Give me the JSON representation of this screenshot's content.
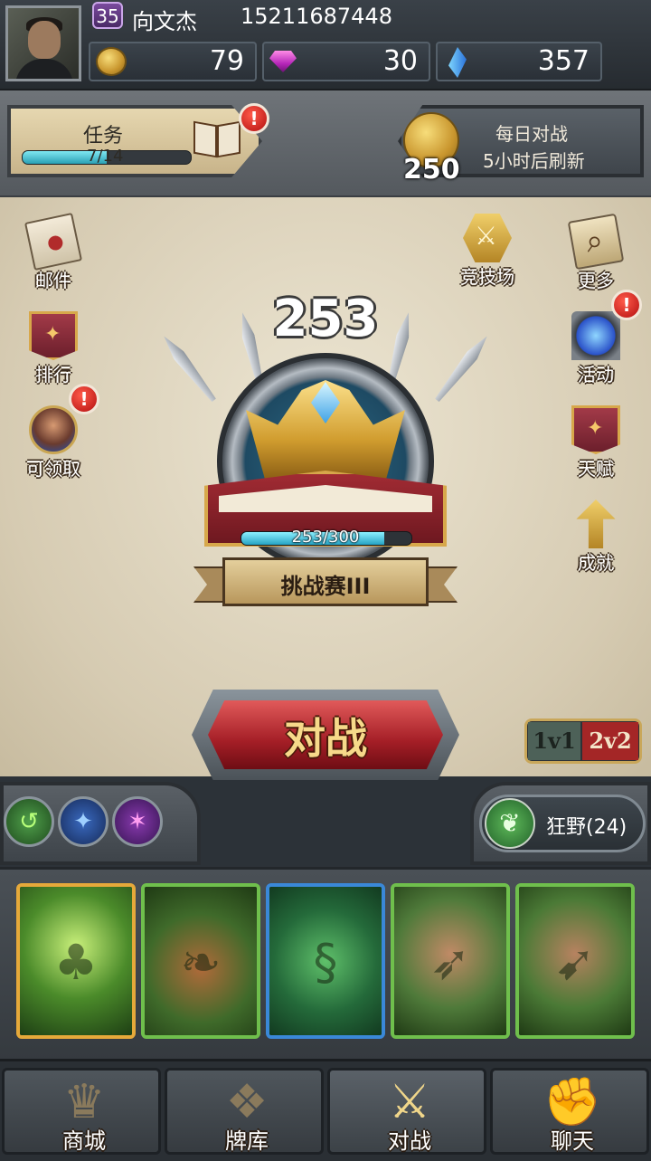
{
  "player": {
    "level": "35",
    "name": "向文杰",
    "phone": "15211687448"
  },
  "resources": {
    "gold": "79",
    "gems": "30",
    "crystals": "357"
  },
  "quest": {
    "title": "任务",
    "progress": "7/14",
    "fraction": 0.5,
    "alert": "!"
  },
  "daily_battle": {
    "coin_count": "250",
    "title": "每日对战",
    "refresh": "5小时后刷新"
  },
  "side_left": {
    "mail": "邮件",
    "ranking": "排行",
    "claimable": "可领取",
    "claimable_alert": "!"
  },
  "side_right": {
    "arena": "竞技场",
    "more": "更多",
    "events": "活动",
    "events_alert": "!",
    "talent": "天赋",
    "achievements": "成就"
  },
  "rank": {
    "points": "253",
    "progress": "253/300",
    "fraction": 0.843,
    "name": "挑战赛III"
  },
  "battle": {
    "label": "对战"
  },
  "mode": {
    "option_1": "1v1",
    "option_2": "2v2",
    "selected": "2v2"
  },
  "deck": {
    "name": "狂野(24)"
  },
  "bottom_nav": {
    "shop": "商城",
    "deck": "牌库",
    "battle": "对战",
    "chat": "聊天",
    "active": "battle"
  },
  "colors": {
    "accent_red": "#a41e26",
    "gold": "#d19d2f",
    "progress_cyan": "#2aa0b4",
    "card_green_border": "#6fbf4c",
    "card_gold_border": "#e6a93a",
    "card_blue_border": "#3a88d8"
  }
}
